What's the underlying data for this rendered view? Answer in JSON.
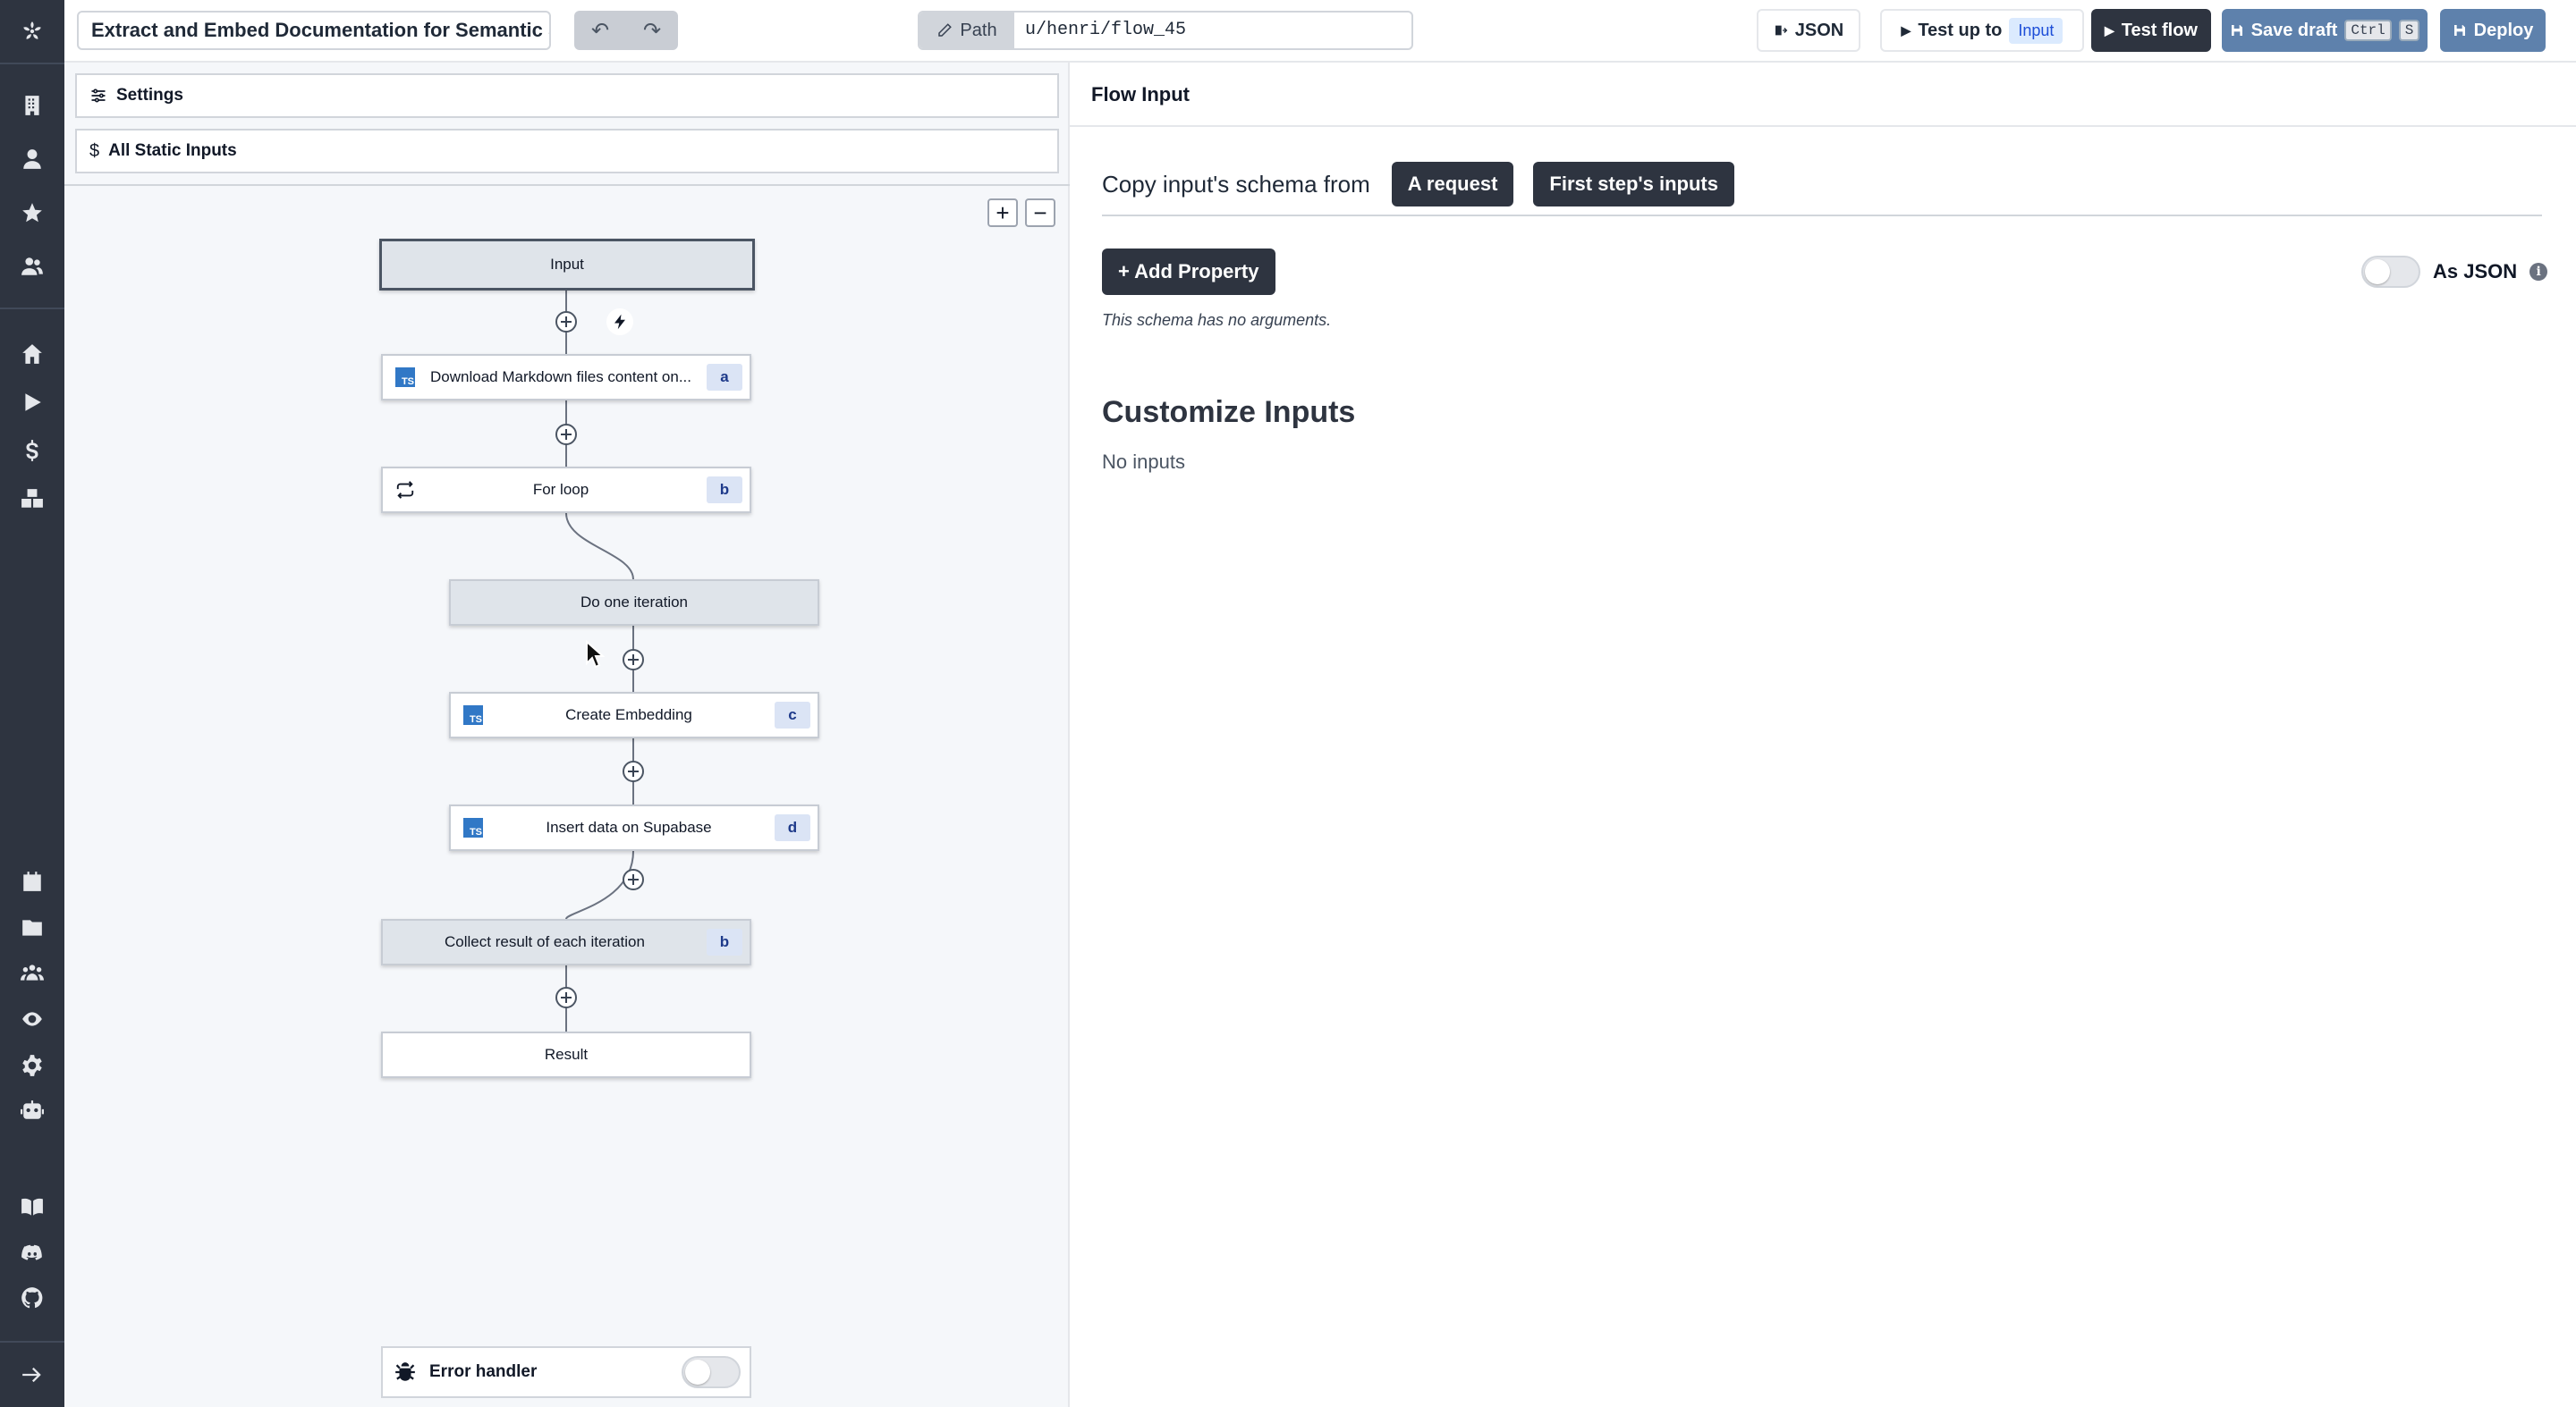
{
  "topbar": {
    "flow_title": "Extract and Embed Documentation for Semantic S",
    "path_label": "Path",
    "path_value": "u/henri/flow_45",
    "json_label": "JSON",
    "test_up_to_label": "Test up to",
    "test_up_to_target": "Input",
    "test_flow_label": "Test flow",
    "save_draft_label": "Save draft",
    "save_draft_key1": "Ctrl",
    "save_draft_key2": "S",
    "deploy_label": "Deploy"
  },
  "sidebar": {
    "top_icons": [
      "windmill-logo-icon",
      "building-icon",
      "user-icon",
      "star-icon",
      "users-icon"
    ],
    "main_icons": [
      "home-icon",
      "play-icon",
      "dollar-icon",
      "boxes-icon"
    ],
    "bottom_icons": [
      "calendar-icon",
      "folder-icon",
      "groups-icon",
      "eye-icon",
      "gear-icon",
      "robot-icon",
      "book-icon",
      "discord-icon",
      "github-icon",
      "expand-arrow-icon"
    ]
  },
  "left_panel": {
    "settings_label": "Settings",
    "static_inputs_label": "All Static Inputs",
    "zoom_in": "+",
    "zoom_out": "−",
    "nodes": [
      {
        "label": "Input"
      },
      {
        "label": "Download Markdown files content on...",
        "badge": "a"
      },
      {
        "label": "For loop",
        "badge": "b"
      },
      {
        "label": "Do one iteration"
      },
      {
        "label": "Create Embedding",
        "badge": "c"
      },
      {
        "label": "Insert data on Supabase",
        "badge": "d"
      },
      {
        "label": "Collect result of each iteration",
        "badge": "b"
      },
      {
        "label": "Result"
      }
    ],
    "error_handler_label": "Error handler",
    "error_handler_enabled": false
  },
  "right_panel": {
    "header": "Flow Input",
    "copy_schema_label": "Copy input's schema from",
    "a_request_label": "A request",
    "first_step_label": "First step's inputs",
    "add_property_label": "+ Add Property",
    "as_json_label": "As JSON",
    "as_json_enabled": false,
    "no_args_text": "This schema has no arguments.",
    "customize_title": "Customize Inputs",
    "no_inputs_text": "No inputs"
  },
  "colors": {
    "sidebar_bg": "#2e3440",
    "dark_button": "#2e3440",
    "blue_button": "#5e81ac",
    "badge_bg": "#dbe4f5",
    "typescript": "#3178c6"
  }
}
